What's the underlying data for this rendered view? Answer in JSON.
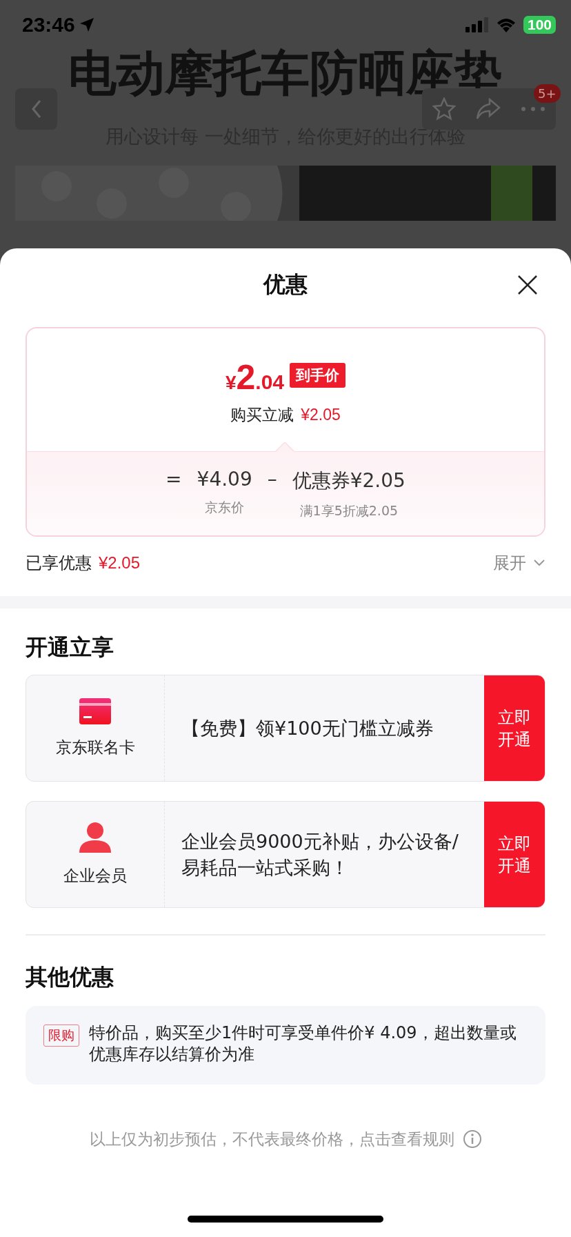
{
  "status_bar": {
    "time": "23:46",
    "battery": "100"
  },
  "background_page": {
    "title": "电动摩托车防晒座垫",
    "subtitle": "用心设计每 一处细节，给你更好的出行体验",
    "badge": "5+"
  },
  "sheet": {
    "title": "优惠",
    "price_card": {
      "currency": "¥",
      "price_int": "2",
      "price_dec": ".04",
      "tag": "到手价",
      "reduction_label": "购买立减",
      "reduction_amount": "¥2.05",
      "formula": {
        "equals": "=",
        "base_price": "¥4.09",
        "base_label": "京东价",
        "minus": "–",
        "coupon": "优惠券¥2.05",
        "coupon_label": "满1享5折减2.05"
      }
    },
    "summary": {
      "label": "已享优惠",
      "amount": "¥2.05",
      "toggle": "展开"
    },
    "open_section": {
      "title": "开通立享",
      "offers": [
        {
          "kind": "card",
          "name": "京东联名卡",
          "text": "【免费】领¥100无门槛立减券",
          "button": "立即开通"
        },
        {
          "kind": "member",
          "name": "企业会员",
          "text": "企业会员9000元补贴，办公设备/易耗品一站式采购！",
          "button": "立即开通"
        }
      ]
    },
    "other_section": {
      "title": "其他优惠",
      "notes": [
        {
          "tag": "限购",
          "text": "特价品，购买至少1件时可享受单件价¥ 4.09，超出数量或优惠库存以结算价为准"
        }
      ]
    },
    "footer": "以上仅为初步预估，不代表最终价格，点击查看规则"
  }
}
